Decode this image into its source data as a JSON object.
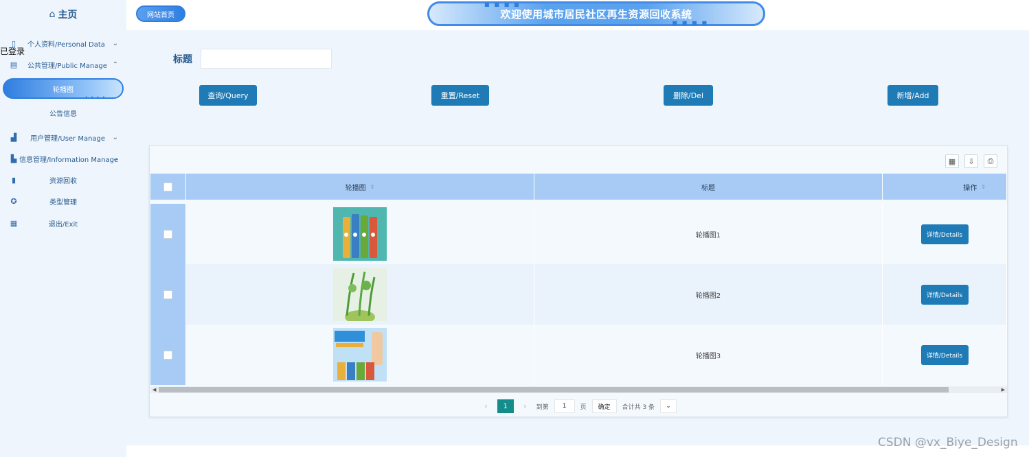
{
  "sidebar": {
    "home": "主页",
    "stray_text": "已登录",
    "items": [
      {
        "label": "个人资料/Personal Data",
        "icon": "document-icon"
      },
      {
        "label": "公共管理/Public Manage",
        "icon": "clipboard-icon"
      },
      {
        "label": "轮播图",
        "icon": ""
      },
      {
        "label": "公告信息",
        "icon": ""
      },
      {
        "label": "用户管理/User Manage",
        "icon": "users-icon"
      },
      {
        "label": "信息管理/Information Manage",
        "icon": "chart-icon"
      },
      {
        "label": "资源回收",
        "icon": "bookmark-icon"
      },
      {
        "label": "类型管理",
        "icon": "badge-icon"
      },
      {
        "label": "退出/Exit",
        "icon": "calendar-icon"
      }
    ]
  },
  "header": {
    "site_home": "网站首页",
    "title": "欢迎使用城市居民社区再生资源回收系统"
  },
  "search": {
    "label": "标题",
    "value": ""
  },
  "buttons": {
    "query": "查询/Query",
    "reset": "重置/Reset",
    "delete": "删除/Del",
    "add": "新增/Add"
  },
  "table": {
    "columns": [
      "轮播图",
      "标题",
      "操作"
    ],
    "rows": [
      {
        "title": "轮播图1",
        "action": "详情/Details"
      },
      {
        "title": "轮播图2",
        "action": "详情/Details"
      },
      {
        "title": "轮播图3",
        "action": "详情/Details"
      }
    ]
  },
  "pager": {
    "current": "1",
    "goto_label": "到第",
    "goto_value": "1",
    "page_unit": "页",
    "confirm": "确定",
    "total": "合计共 3 条"
  },
  "watermark": "CSDN @vx_Biye_Design",
  "colors": {
    "primary_button": "#1f7bb6",
    "sidebar_bg": "#eef5fd",
    "table_header": "#a8cbf6",
    "pager_active": "#158c8c"
  }
}
